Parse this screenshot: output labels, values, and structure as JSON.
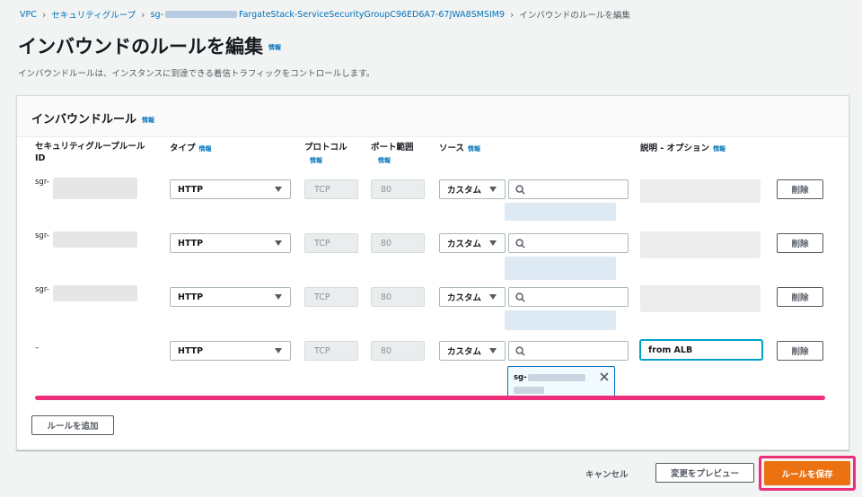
{
  "breadcrumb": {
    "items": [
      "VPC",
      "セキュリティグループ",
      "sg-",
      "FargateStack-ServiceSecurityGroupC96ED6A7-67JWA8SMSIM9",
      "インバウンドのルールを編集"
    ]
  },
  "page": {
    "title": "インバウンドのルールを編集",
    "title_info": "情報",
    "description": "インバウンドルールは、インスタンスに到達できる着信トラフィックをコントロールします。"
  },
  "panel": {
    "title": "インバウンドルール",
    "title_info": "情報",
    "columns": {
      "rule_id_line1": "セキュリティグループルール",
      "rule_id_line2": "ID",
      "type": "タイプ",
      "type_info": "情報",
      "protocol": "プロトコル",
      "protocol_info": "情報",
      "port": "ポート範囲",
      "port_info": "情報",
      "source": "ソース",
      "source_info": "情報",
      "description": "説明 - オプション",
      "description_info": "情報"
    },
    "rows": [
      {
        "rule_id": "sgr-",
        "type": "HTTP",
        "protocol": "TCP",
        "port": "80",
        "source_type": "カスタム",
        "delete": "削除"
      },
      {
        "rule_id": "sgr-",
        "type": "HTTP",
        "protocol": "TCP",
        "port": "80",
        "source_type": "カスタム",
        "delete": "削除"
      },
      {
        "rule_id": "sgr-",
        "type": "HTTP",
        "protocol": "TCP",
        "port": "80",
        "source_type": "カスタム",
        "delete": "削除"
      },
      {
        "rule_id": "–",
        "type": "HTTP",
        "protocol": "TCP",
        "port": "80",
        "source_type": "カスタム",
        "description_value": "from ALB",
        "delete": "削除",
        "chip": "sg-"
      }
    ],
    "add_rule": "ルールを追加"
  },
  "footer": {
    "cancel": "キャンセル",
    "preview": "変更をプレビュー",
    "save": "ルールを保存"
  },
  "colors": {
    "link": "#0073bb",
    "primary": "#ec7211",
    "highlight": "#ec2e7b"
  }
}
